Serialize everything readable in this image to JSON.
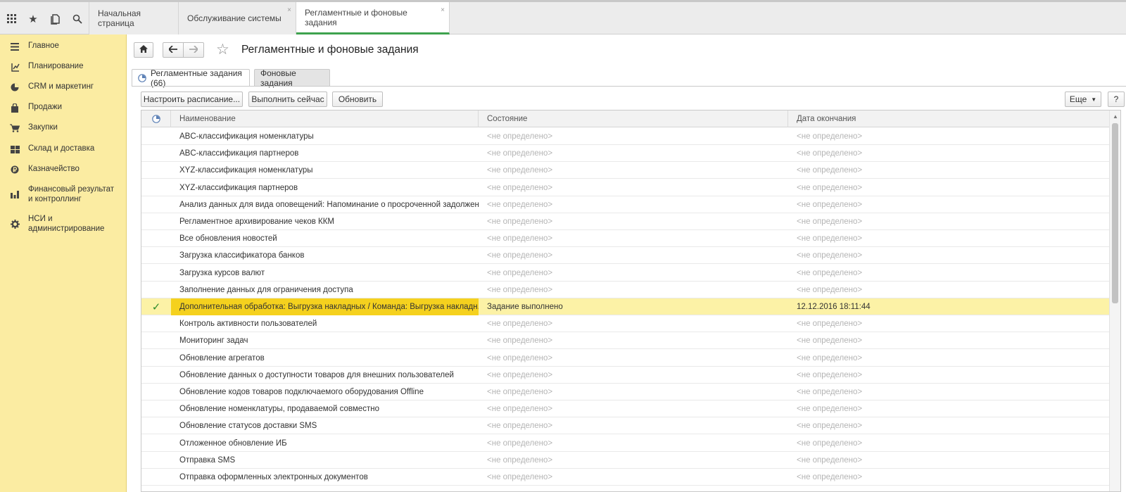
{
  "topbar": {
    "icons": [
      "apps-grid-icon",
      "favorites-star-icon",
      "history-icon",
      "search-icon"
    ],
    "tabs": [
      {
        "label": "Начальная страница",
        "closable": false,
        "active": false
      },
      {
        "label": "Обслуживание системы",
        "closable": true,
        "active": false
      },
      {
        "label": "Регламентные и фоновые задания",
        "closable": true,
        "active": true
      }
    ],
    "close_glyph": "×"
  },
  "sidebar": {
    "items": [
      {
        "label": "Главное",
        "icon": "menu-lines-icon"
      },
      {
        "label": "Планирование",
        "icon": "planning-icon"
      },
      {
        "label": "CRM и маркетинг",
        "icon": "pie-chart-icon"
      },
      {
        "label": "Продажи",
        "icon": "shopping-bag-icon"
      },
      {
        "label": "Закупки",
        "icon": "cart-icon"
      },
      {
        "label": "Склад и доставка",
        "icon": "warehouse-icon"
      },
      {
        "label": "Казначейство",
        "icon": "ruble-coin-icon"
      },
      {
        "label": "Финансовый результат и контроллинг",
        "icon": "bar-chart-icon"
      },
      {
        "label": "НСИ и администрирование",
        "icon": "gear-icon"
      }
    ]
  },
  "page": {
    "title": "Регламентные и фоновые задания",
    "subtabs": [
      {
        "label": "Регламентные задания (66)",
        "active": true
      },
      {
        "label": "Фоновые задания",
        "active": false
      }
    ]
  },
  "toolbar": {
    "schedule_label": "Настроить расписание...",
    "run_now_label": "Выполнить сейчас",
    "refresh_label": "Обновить",
    "more_label": "Еще",
    "help_label": "?"
  },
  "grid": {
    "columns": [
      "Наименование",
      "Состояние",
      "Дата окончания"
    ],
    "rows": [
      {
        "name": "ABC-классификация номенклатуры",
        "state": "<не определено>",
        "date": "<не определено>",
        "check": ""
      },
      {
        "name": "ABC-классификация партнеров",
        "state": "<не определено>",
        "date": "<не определено>",
        "check": ""
      },
      {
        "name": "XYZ-классификация номенклатуры",
        "state": "<не определено>",
        "date": "<не определено>",
        "check": ""
      },
      {
        "name": "XYZ-классификация партнеров",
        "state": "<не определено>",
        "date": "<не определено>",
        "check": ""
      },
      {
        "name": "Анализ данных для вида оповещений: Напоминание о просроченной задолжен...",
        "state": "<не определено>",
        "date": "<не определено>",
        "check": ""
      },
      {
        "name": "Регламентное архивирование чеков ККМ",
        "state": "<не определено>",
        "date": "<не определено>",
        "check": ""
      },
      {
        "name": "Все обновления новостей",
        "state": "<не определено>",
        "date": "<не определено>",
        "check": ""
      },
      {
        "name": "Загрузка классификатора банков",
        "state": "<не определено>",
        "date": "<не определено>",
        "check": ""
      },
      {
        "name": "Загрузка курсов валют",
        "state": "<не определено>",
        "date": "<не определено>",
        "check": ""
      },
      {
        "name": "Заполнение данных для ограничения доступа",
        "state": "<не определено>",
        "date": "<не определено>",
        "check": ""
      },
      {
        "name": "Дополнительная обработка: Выгрузка накладных / Команда: Выгрузка накладн...",
        "state": "Задание выполнено",
        "date": "12.12.2016 18:11:44",
        "check": "✓",
        "selected": true
      },
      {
        "name": "Контроль активности пользователей",
        "state": "<не определено>",
        "date": "<не определено>",
        "check": ""
      },
      {
        "name": "Мониторинг задач",
        "state": "<не определено>",
        "date": "<не определено>",
        "check": ""
      },
      {
        "name": "Обновление агрегатов",
        "state": "<не определено>",
        "date": "<не определено>",
        "check": ""
      },
      {
        "name": "Обновление данных о доступности товаров для внешних пользователей",
        "state": "<не определено>",
        "date": "<не определено>",
        "check": ""
      },
      {
        "name": "Обновление кодов товаров подключаемого оборудования Offline",
        "state": "<не определено>",
        "date": "<не определено>",
        "check": ""
      },
      {
        "name": "Обновление номенклатуры, продаваемой совместно",
        "state": "<не определено>",
        "date": "<не определено>",
        "check": ""
      },
      {
        "name": "Обновление статусов доставки SMS",
        "state": "<не определено>",
        "date": "<не определено>",
        "check": ""
      },
      {
        "name": "Отложенное обновление ИБ",
        "state": "<не определено>",
        "date": "<не определено>",
        "check": ""
      },
      {
        "name": "Отправка SMS",
        "state": "<не определено>",
        "date": "<не определено>",
        "check": ""
      },
      {
        "name": "Отправка оформленных электронных документов",
        "state": "<не определено>",
        "date": "<не определено>",
        "check": ""
      }
    ]
  },
  "colors": {
    "sidebar_bg": "#fbeca2",
    "active_tab_underline": "#3ea24e",
    "selected_row": "#fcf2a6",
    "selected_cell": "#f5d11e",
    "check": "#2d8c2d"
  }
}
